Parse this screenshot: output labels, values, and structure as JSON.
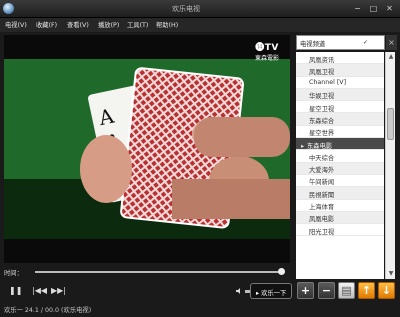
{
  "window": {
    "title": "欢乐电视",
    "buttons": {
      "minimize": "−",
      "maximize": "□",
      "close": "✕"
    }
  },
  "menu": [
    {
      "label": "电视(V)"
    },
    {
      "label": "收藏(F)"
    },
    {
      "label": "查看(V)"
    },
    {
      "label": "播放(P)"
    },
    {
      "label": "工具(T)"
    },
    {
      "label": "帮助(H)"
    }
  ],
  "video": {
    "channel_logo_top": "⓮TV",
    "channel_logo_bottom": "東森電影"
  },
  "seek": {
    "label": "时间：",
    "progress": 0.98
  },
  "controls": {
    "play_pause_icon": "pause-icon",
    "prev_icon": "previous-icon",
    "next_icon": "next-icon",
    "volume_icon": "volume-icon",
    "status_button": "▸ 欢乐一下"
  },
  "panel": {
    "header_label": "电视频道",
    "dropdown_glyph": "✓",
    "close_glyph": "×",
    "channels": [
      {
        "label": "凤凰资讯",
        "group": false
      },
      {
        "label": "凤凰卫视",
        "group": false
      },
      {
        "label": "Channel [V]",
        "group": false
      },
      {
        "label": "华娱卫视",
        "group": false
      },
      {
        "label": "星空卫视",
        "group": false
      },
      {
        "label": "东森综合",
        "group": false
      },
      {
        "label": "星空世界",
        "group": false
      },
      {
        "label": "东森电影",
        "group": true
      },
      {
        "label": "中天综合",
        "group": false
      },
      {
        "label": "大爱海外",
        "group": false
      },
      {
        "label": "午间新闻",
        "group": false
      },
      {
        "label": "民視新聞",
        "group": false
      },
      {
        "label": "上海体育",
        "group": false
      },
      {
        "label": "凤凰电影",
        "group": false
      },
      {
        "label": "阳光卫视",
        "group": false
      }
    ],
    "buttons": [
      {
        "glyph": "+",
        "name": "add-channel-button",
        "style": ""
      },
      {
        "glyph": "−",
        "name": "remove-channel-button",
        "style": ""
      },
      {
        "glyph": "▤",
        "name": "edit-list-button",
        "style": "light"
      },
      {
        "glyph": "↑",
        "name": "move-up-button",
        "style": "orange"
      },
      {
        "glyph": "↓",
        "name": "move-down-button",
        "style": "orange"
      }
    ]
  },
  "status": {
    "text": "欢乐一  24.1 / 00.0 (欢乐电视)"
  }
}
